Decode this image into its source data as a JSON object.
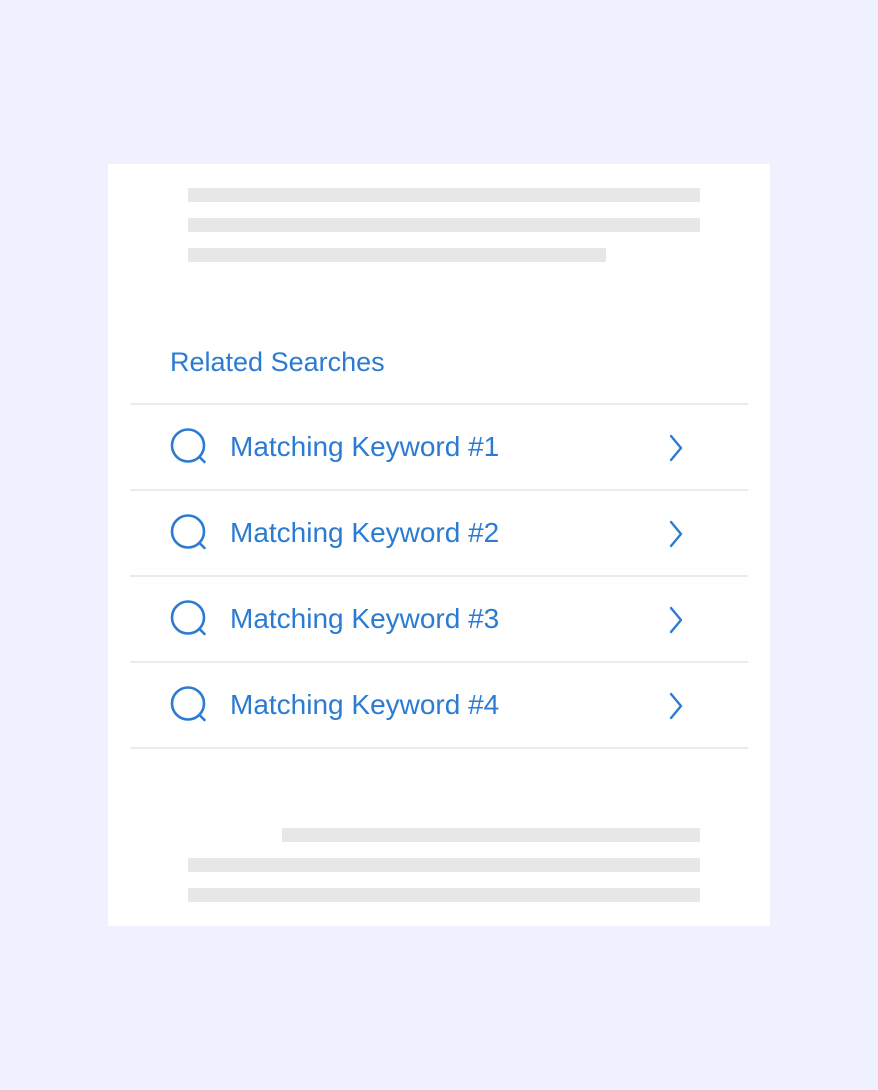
{
  "colors": {
    "background": "#eff2fe",
    "card": "#ffffff",
    "accent": "#2b7bd3",
    "divider": "#ebebeb",
    "placeholder": "#e7e7e7"
  },
  "related_searches": {
    "title": "Related Searches",
    "items": [
      {
        "label": "Matching Keyword #1",
        "icon": "search-icon",
        "action_icon": "chevron-right-icon"
      },
      {
        "label": "Matching Keyword #2",
        "icon": "search-icon",
        "action_icon": "chevron-right-icon"
      },
      {
        "label": "Matching Keyword #3",
        "icon": "search-icon",
        "action_icon": "chevron-right-icon"
      },
      {
        "label": "Matching Keyword #4",
        "icon": "search-icon",
        "action_icon": "chevron-right-icon"
      }
    ]
  }
}
